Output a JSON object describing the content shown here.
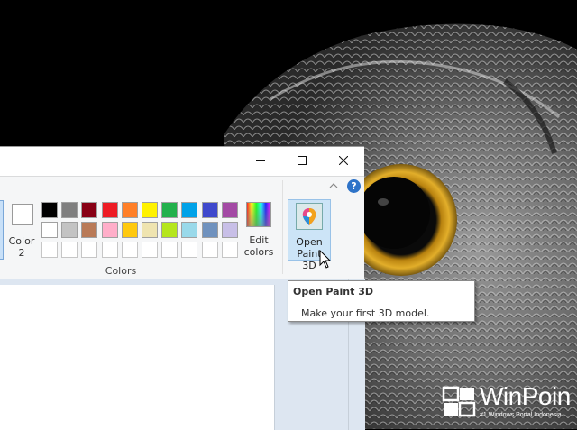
{
  "window": {
    "controls": [
      "minimize",
      "maximize",
      "close"
    ]
  },
  "ribbon": {
    "color2_label": "Color\n2",
    "edit_colors_label": "Edit\ncolors",
    "group_label": "Colors",
    "open_paint3d_label": "Open\nPaint 3D",
    "help_label": "?",
    "palette": {
      "row1": [
        "#000000",
        "#7f7f7f",
        "#880015",
        "#ed1c24",
        "#ff7f27",
        "#fff200",
        "#22b14c",
        "#00a2e8",
        "#3f48cc",
        "#a349a4"
      ],
      "row2": [
        "#ffffff",
        "#c3c3c3",
        "#b97a57",
        "#ffaec9",
        "#ffc90e",
        "#efe4b0",
        "#b5e61d",
        "#99d9ea",
        "#7092be",
        "#c8bfe7"
      ],
      "row3_empty_count": 10
    }
  },
  "tooltip": {
    "title": "Open Paint 3D",
    "description": "Make your first 3D model."
  },
  "watermark": {
    "brand": "WinPoin",
    "tagline": "#1 Windows Portal Indonesia"
  },
  "colors": {
    "accent_blue": "#2e73c8",
    "selected_bg": "#cce4f7"
  }
}
